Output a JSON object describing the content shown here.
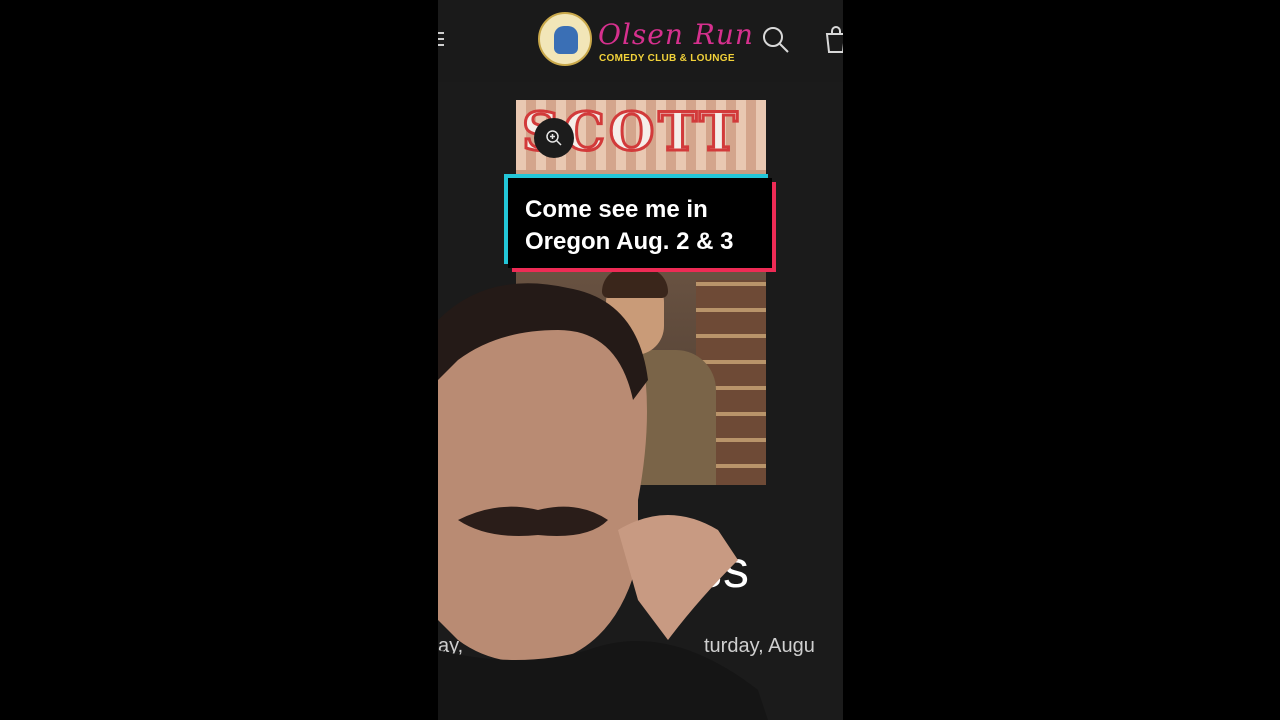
{
  "header": {
    "logo_title": "Olsen Run",
    "logo_subtitle": "COMEDY CLUB & LOUNGE",
    "icons": [
      "menu-icon",
      "search-icon",
      "cart-icon"
    ]
  },
  "poster": {
    "name_text": "SCOTT",
    "zoom_icon": "zoom-in-icon"
  },
  "caption": {
    "line1": "Come see me in",
    "line2": "Oregon Aug. 2 & 3"
  },
  "event": {
    "title_fragment": "ss",
    "date_left_fragment": "ay,",
    "date_right_fragment": "turday, Augu"
  },
  "colors": {
    "logo_pink": "#d6308e",
    "logo_yellow": "#f2d23a",
    "caption_cyan": "#23c6d8",
    "caption_red": "#ee2b55"
  }
}
